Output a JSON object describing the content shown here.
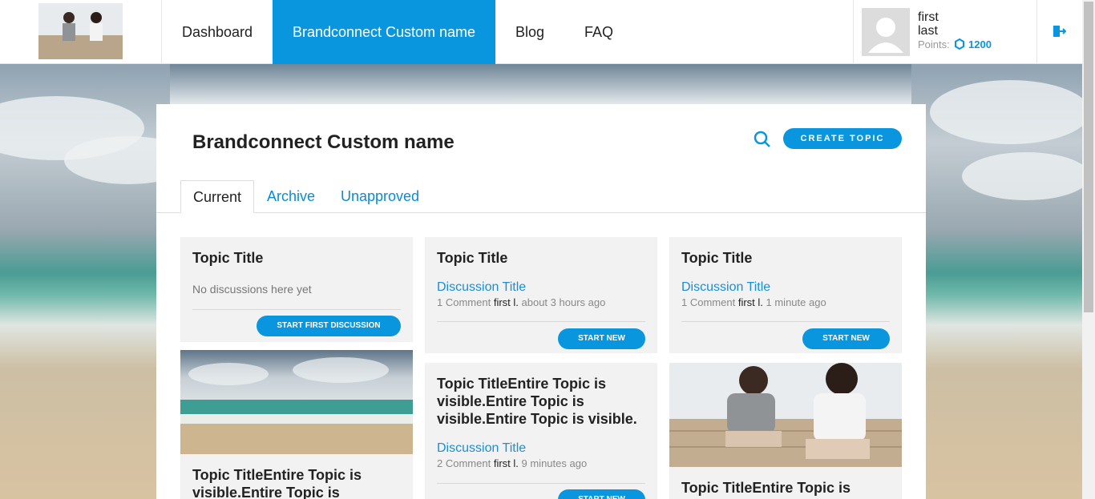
{
  "nav": {
    "items": [
      {
        "label": "Dashboard"
      },
      {
        "label": "Brandconnect Custom name"
      },
      {
        "label": "Blog"
      },
      {
        "label": "FAQ"
      }
    ]
  },
  "profile": {
    "first": "first",
    "last": "last",
    "points_label": "Points:",
    "points_value": "1200"
  },
  "page": {
    "title": "Brandconnect Custom name",
    "create_button": "CREATE TOPIC"
  },
  "tabs": [
    {
      "label": "Current"
    },
    {
      "label": "Archive"
    },
    {
      "label": "Unapproved"
    }
  ],
  "cards": {
    "c1": {
      "title": "Topic Title",
      "empty": "No discussions here yet",
      "button": "START FIRST DISCUSSION"
    },
    "c2": {
      "title": "Topic Title",
      "disc_title": "Discussion Title",
      "meta_count": "1 Comment",
      "meta_who": "first l.",
      "meta_time": "about 3 hours ago",
      "button": "START NEW"
    },
    "c3": {
      "title": "Topic Title",
      "disc_title": "Discussion Title",
      "meta_count": "1 Comment",
      "meta_who": "first l.",
      "meta_time": "1 minute ago",
      "button": "START NEW"
    },
    "c4": {
      "title": "Topic TitleEntire Topic is visible.Entire Topic is"
    },
    "c5": {
      "title": "Topic TitleEntire Topic is visible.Entire Topic is visible.Entire Topic is visible.",
      "disc_title": "Discussion Title",
      "meta_count": "2 Comment",
      "meta_who": "first l.",
      "meta_time": "9 minutes ago",
      "button": "START NEW"
    },
    "c6": {
      "title": "Topic TitleEntire Topic is"
    }
  },
  "colors": {
    "accent": "#0a96df",
    "link": "#1a8fd3"
  }
}
